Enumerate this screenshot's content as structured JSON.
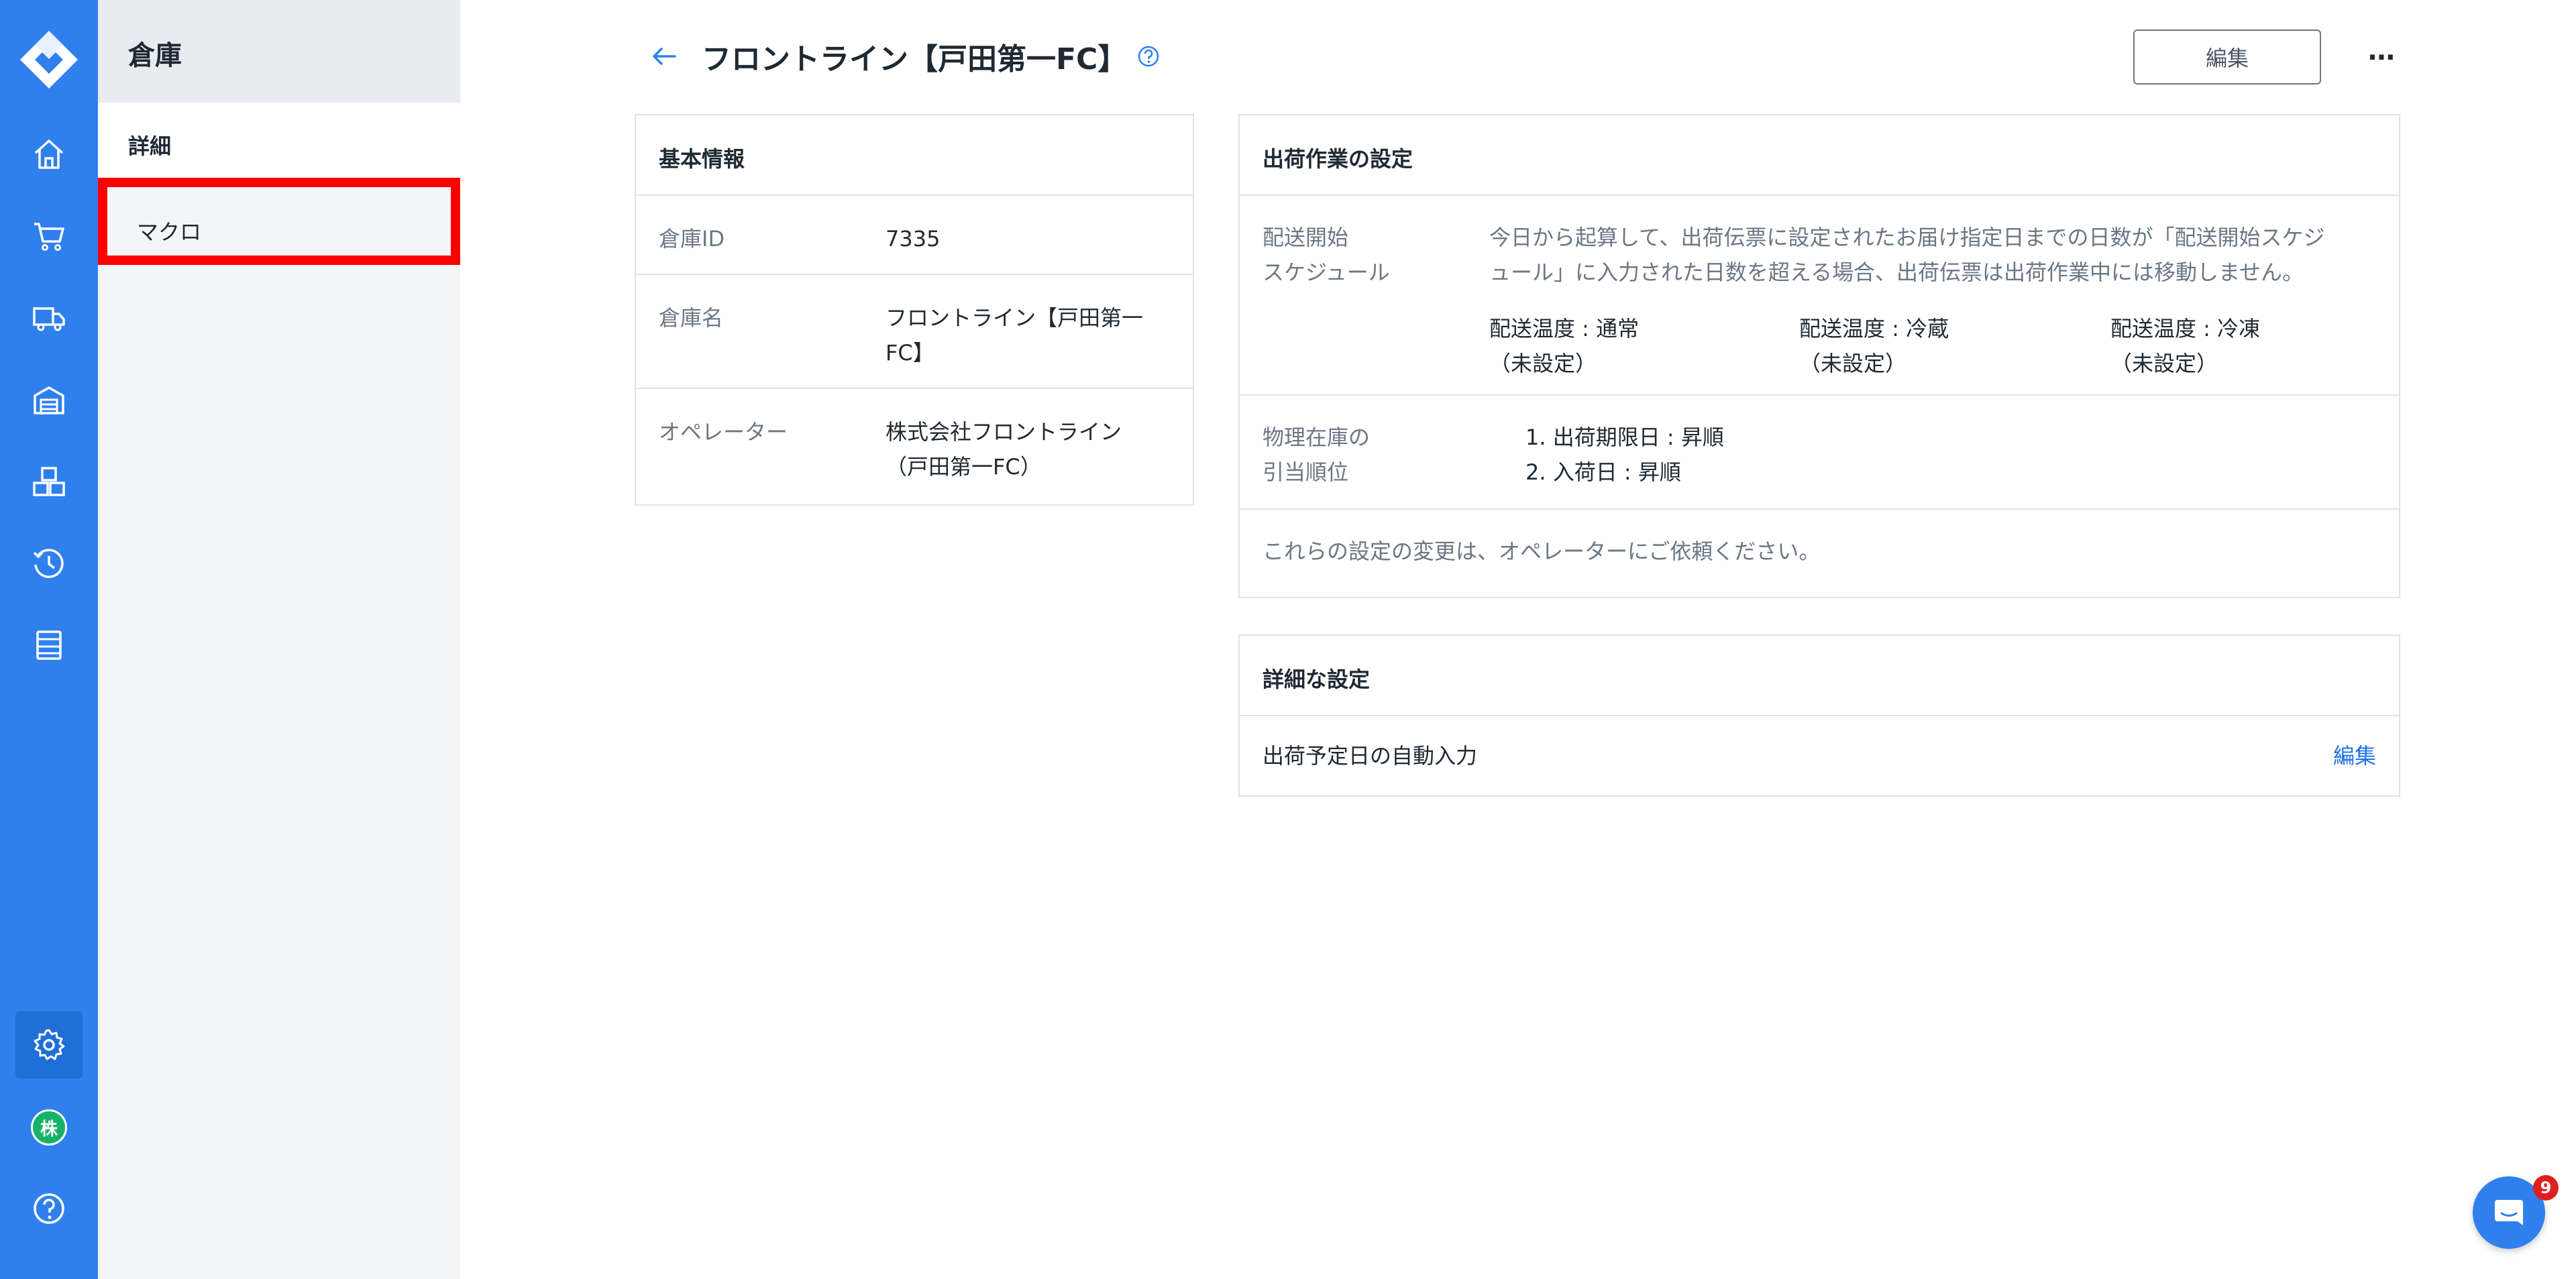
{
  "sidebar": {
    "icons": [
      "logo-icon",
      "home-icon",
      "cart-icon",
      "truck-icon",
      "warehouse-icon",
      "boxes-icon",
      "history-icon",
      "list-icon",
      "gear-icon",
      "help-icon"
    ],
    "company_badge": "株",
    "active_icon": "gear-icon"
  },
  "subnav": {
    "title": "倉庫",
    "items": [
      {
        "label": "詳細",
        "state": "current"
      },
      {
        "label": "マクロ",
        "state": "highlighted"
      }
    ]
  },
  "header": {
    "title": "フロントライン【戸田第一FC】",
    "edit_label": "編集",
    "more_label": "⋯"
  },
  "basic_info": {
    "title": "基本情報",
    "rows": [
      {
        "label": "倉庫ID",
        "value": "7335"
      },
      {
        "label": "倉庫名",
        "value_line1": "フロントライン【戸田第一",
        "value_line2": "FC】"
      },
      {
        "label": "オペレーター",
        "value_line1": "株式会社フロントライン",
        "value_line2": "（戸田第一FC）"
      }
    ]
  },
  "shipping": {
    "title": "出荷作業の設定",
    "schedule": {
      "label_line1": "配送開始",
      "label_line2": "スケジュール",
      "desc_line1": "今日から起算して、出荷伝票に設定されたお届け指定日までの日数が「配送開始スケジ",
      "desc_line2": "ュール」に入力された日数を超える場合、出荷伝票は出荷作業中には移動しません。",
      "temps": [
        {
          "label": "配送温度 : 通常",
          "note": "（未設定）"
        },
        {
          "label": "配送温度 : 冷蔵",
          "note": "（未設定）"
        },
        {
          "label": "配送温度 : 冷凍",
          "note": "（未設定）"
        }
      ]
    },
    "allocation": {
      "label_line1": "物理在庫の",
      "label_line2": "引当順位",
      "items": [
        "1. 出荷期限日 : 昇順",
        "2. 入荷日 : 昇順"
      ]
    },
    "note": "これらの設定の変更は、オペレーターにご依頼ください。"
  },
  "advanced": {
    "title": "詳細な設定",
    "row_label": "出荷予定日の自動入力",
    "row_action": "編集"
  },
  "chat": {
    "badge_count": "9"
  },
  "colors": {
    "rail": "#2f80ed",
    "highlight": "#ff0000",
    "link": "#1a73e8"
  }
}
